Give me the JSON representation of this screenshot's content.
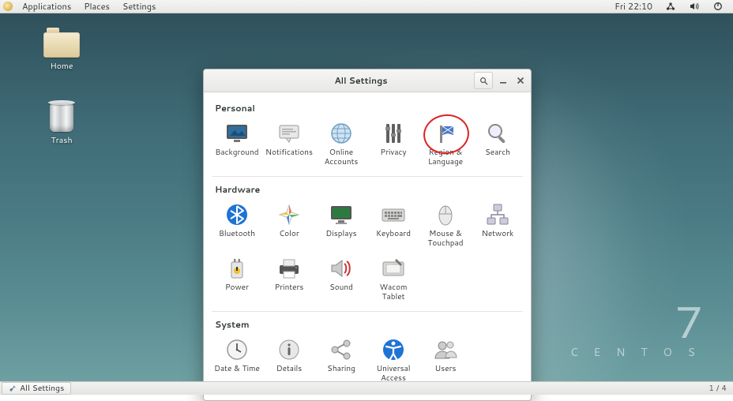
{
  "topbar": {
    "menu": [
      "Applications",
      "Places",
      "Settings"
    ],
    "clock": "Fri 22:10"
  },
  "desktop": {
    "icons": {
      "home": "Home",
      "trash": "Trash"
    },
    "brand": {
      "version": "7",
      "name": "C E N T O S"
    }
  },
  "window": {
    "title": "All Settings",
    "sections": {
      "personal": {
        "heading": "Personal",
        "items": [
          "Background",
          "Notifications",
          "Online Accounts",
          "Privacy",
          "Region & Language",
          "Search"
        ]
      },
      "hardware": {
        "heading": "Hardware",
        "items": [
          "Bluetooth",
          "Color",
          "Displays",
          "Keyboard",
          "Mouse & Touchpad",
          "Network",
          "Power",
          "Printers",
          "Sound",
          "Wacom Tablet"
        ]
      },
      "system": {
        "heading": "System",
        "items": [
          "Date & Time",
          "Details",
          "Sharing",
          "Universal Access",
          "Users"
        ]
      }
    }
  },
  "bottombar": {
    "task": "All Settings",
    "workspace": "1 / 4"
  }
}
